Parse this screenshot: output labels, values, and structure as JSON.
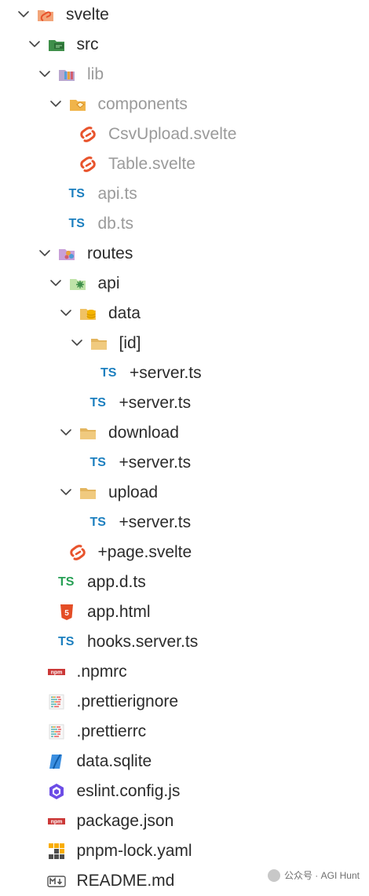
{
  "tree": [
    {
      "id": "svelte-root",
      "label": "svelte",
      "icon": "svelte-folder-icon",
      "depth": 0,
      "chevron": true,
      "dim": false
    },
    {
      "id": "src",
      "label": "src",
      "icon": "src-folder-icon",
      "depth": 1,
      "chevron": true,
      "dim": false
    },
    {
      "id": "lib",
      "label": "lib",
      "icon": "lib-folder-icon",
      "depth": 2,
      "chevron": true,
      "dim": true
    },
    {
      "id": "components",
      "label": "components",
      "icon": "components-folder-icon",
      "depth": 3,
      "chevron": true,
      "dim": true
    },
    {
      "id": "csvupload",
      "label": "CsvUpload.svelte",
      "icon": "svelte-file-icon",
      "depth": 4,
      "chevron": false,
      "dim": true
    },
    {
      "id": "table",
      "label": "Table.svelte",
      "icon": "svelte-file-icon",
      "depth": 4,
      "chevron": false,
      "dim": true
    },
    {
      "id": "api-ts",
      "label": "api.ts",
      "icon": "ts-file-icon",
      "depth": 3,
      "chevron": false,
      "dim": true
    },
    {
      "id": "db-ts",
      "label": "db.ts",
      "icon": "ts-file-icon",
      "depth": 3,
      "chevron": false,
      "dim": true
    },
    {
      "id": "routes",
      "label": "routes",
      "icon": "routes-folder-icon",
      "depth": 2,
      "chevron": true,
      "dim": false
    },
    {
      "id": "api",
      "label": "api",
      "icon": "api-folder-icon",
      "depth": 3,
      "chevron": true,
      "dim": false
    },
    {
      "id": "data",
      "label": "data",
      "icon": "data-folder-icon",
      "depth": 4,
      "chevron": true,
      "dim": false
    },
    {
      "id": "id",
      "label": "[id]",
      "icon": "plain-folder-icon",
      "depth": 5,
      "chevron": true,
      "dim": false
    },
    {
      "id": "server-id",
      "label": "+server.ts",
      "icon": "ts-file-icon",
      "depth": 6,
      "chevron": false,
      "dim": false
    },
    {
      "id": "server-data",
      "label": "+server.ts",
      "icon": "ts-file-icon",
      "depth": 5,
      "chevron": false,
      "dim": false
    },
    {
      "id": "download",
      "label": "download",
      "icon": "plain-folder-icon",
      "depth": 4,
      "chevron": true,
      "dim": false
    },
    {
      "id": "server-download",
      "label": "+server.ts",
      "icon": "ts-file-icon",
      "depth": 5,
      "chevron": false,
      "dim": false
    },
    {
      "id": "upload",
      "label": "upload",
      "icon": "plain-folder-icon",
      "depth": 4,
      "chevron": true,
      "dim": false
    },
    {
      "id": "server-upload",
      "label": "+server.ts",
      "icon": "ts-file-icon",
      "depth": 5,
      "chevron": false,
      "dim": false
    },
    {
      "id": "page-svelte",
      "label": "+page.svelte",
      "icon": "svelte-file-icon",
      "depth": 3,
      "chevron": false,
      "dim": false
    },
    {
      "id": "app-d-ts",
      "label": "app.d.ts",
      "icon": "ts-def-file-icon",
      "depth": 2,
      "chevron": false,
      "dim": false
    },
    {
      "id": "app-html",
      "label": "app.html",
      "icon": "html-file-icon",
      "depth": 2,
      "chevron": false,
      "dim": false
    },
    {
      "id": "hooks",
      "label": "hooks.server.ts",
      "icon": "ts-file-icon",
      "depth": 2,
      "chevron": false,
      "dim": false
    },
    {
      "id": "npmrc",
      "label": ".npmrc",
      "icon": "npm-file-icon",
      "depth": 1,
      "chevron": false,
      "dim": false
    },
    {
      "id": "prettierignore",
      "label": ".prettierignore",
      "icon": "prettier-file-icon",
      "depth": 1,
      "chevron": false,
      "dim": false
    },
    {
      "id": "prettierrc",
      "label": ".prettierrc",
      "icon": "prettier-file-icon",
      "depth": 1,
      "chevron": false,
      "dim": false
    },
    {
      "id": "sqlite",
      "label": "data.sqlite",
      "icon": "database-file-icon",
      "depth": 1,
      "chevron": false,
      "dim": false
    },
    {
      "id": "eslint",
      "label": "eslint.config.js",
      "icon": "eslint-file-icon",
      "depth": 1,
      "chevron": false,
      "dim": false
    },
    {
      "id": "package",
      "label": "package.json",
      "icon": "npm-file-icon",
      "depth": 1,
      "chevron": false,
      "dim": false
    },
    {
      "id": "pnpm-lock",
      "label": "pnpm-lock.yaml",
      "icon": "pnpm-file-icon",
      "depth": 1,
      "chevron": false,
      "dim": false
    },
    {
      "id": "readme",
      "label": "README.md",
      "icon": "markdown-file-icon",
      "depth": 1,
      "chevron": false,
      "dim": false
    }
  ],
  "ts_badge": "TS",
  "watermark": "公众号 · AGI Hunt",
  "colors": {
    "ts_blue": "#1c7fbf",
    "ts_green": "#27a055",
    "svelte_orange": "#e8532c",
    "folder_tan": "#e3b55f",
    "dim_text": "#9a9a9a"
  }
}
